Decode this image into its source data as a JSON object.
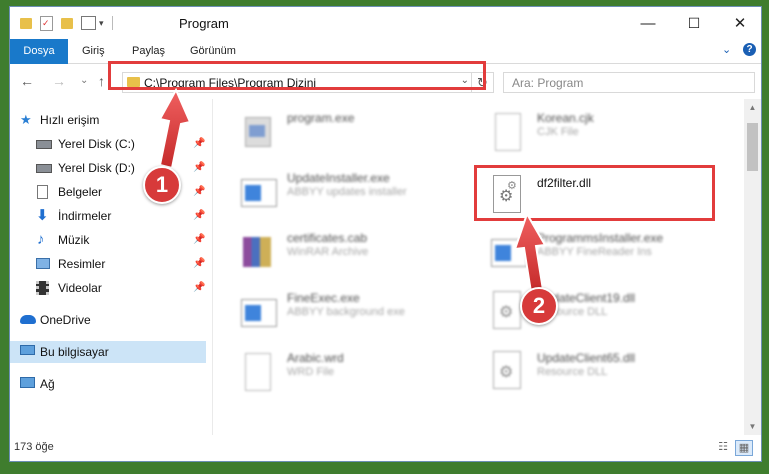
{
  "window": {
    "title": "Program",
    "minimize": "—",
    "maximize": "☐",
    "close": "✕"
  },
  "ribbon": {
    "tabs": [
      "Dosya",
      "Giriş",
      "Paylaş",
      "Görünüm"
    ],
    "collapse_glyph": "⌄",
    "help_glyph": "?"
  },
  "nav": {
    "back": "←",
    "forward": "→",
    "recent": "⌄",
    "up": "↑",
    "address": "C:\\Program Files\\Program Dizini",
    "address_dd": "⌄",
    "refresh": "↻",
    "search_placeholder": "Ara: Program"
  },
  "sidebar": {
    "items": [
      {
        "label": "Hızlı erişim",
        "icon": "star-icon",
        "pinned": false
      },
      {
        "label": "Yerel Disk (C:)",
        "icon": "drive-icon",
        "pinned": true
      },
      {
        "label": "Yerel Disk (D:)",
        "icon": "drive-icon",
        "pinned": true
      },
      {
        "label": "Belgeler",
        "icon": "documents-icon",
        "pinned": true
      },
      {
        "label": "İndirmeler",
        "icon": "download-icon",
        "pinned": true
      },
      {
        "label": "Müzik",
        "icon": "music-icon",
        "pinned": true
      },
      {
        "label": "Resimler",
        "icon": "pictures-icon",
        "pinned": true
      },
      {
        "label": "Videolar",
        "icon": "videos-icon",
        "pinned": true
      },
      {
        "label": "OneDrive",
        "icon": "cloud-icon",
        "pinned": false
      },
      {
        "label": "Bu bilgisayar",
        "icon": "computer-icon",
        "pinned": false
      },
      {
        "label": "Ağ",
        "icon": "network-icon",
        "pinned": false
      }
    ],
    "pin_glyph": "📌"
  },
  "files": [
    {
      "name": "program.exe",
      "type": "",
      "icon": "exe-icon"
    },
    {
      "name": "Korean.cjk",
      "type": "CJK File",
      "icon": "blank-file-icon"
    },
    {
      "name": "UpdateInstaller.exe",
      "type": "ABBYY updates installer",
      "icon": "window-exe-icon"
    },
    {
      "name": "df2filter.dll",
      "type": "",
      "icon": "dll-gear-icon"
    },
    {
      "name": "certificates.cab",
      "type": "WinRAR Archive",
      "icon": "archive-icon"
    },
    {
      "name": "ProgrammsInstaller.exe",
      "type": "ABBYY FineReader Ins",
      "icon": "window-exe-icon"
    },
    {
      "name": "FineExec.exe",
      "type": "ABBYY background exe",
      "icon": "window-exe-icon"
    },
    {
      "name": "UpdateClient19.dll",
      "type": "Resource DLL",
      "icon": "dll-gear-icon"
    },
    {
      "name": "Arabic.wrd",
      "type": "WRD File",
      "icon": "blank-file-icon"
    },
    {
      "name": "UpdateClient65.dll",
      "type": "Resource DLL",
      "icon": "dll-gear-icon"
    }
  ],
  "status": {
    "count": "173 öğe"
  },
  "annotations": {
    "step1": "1",
    "step2": "2"
  },
  "colors": {
    "accent": "#1979ca",
    "highlight": "#e23c3c",
    "selected": "#cce4f7"
  }
}
